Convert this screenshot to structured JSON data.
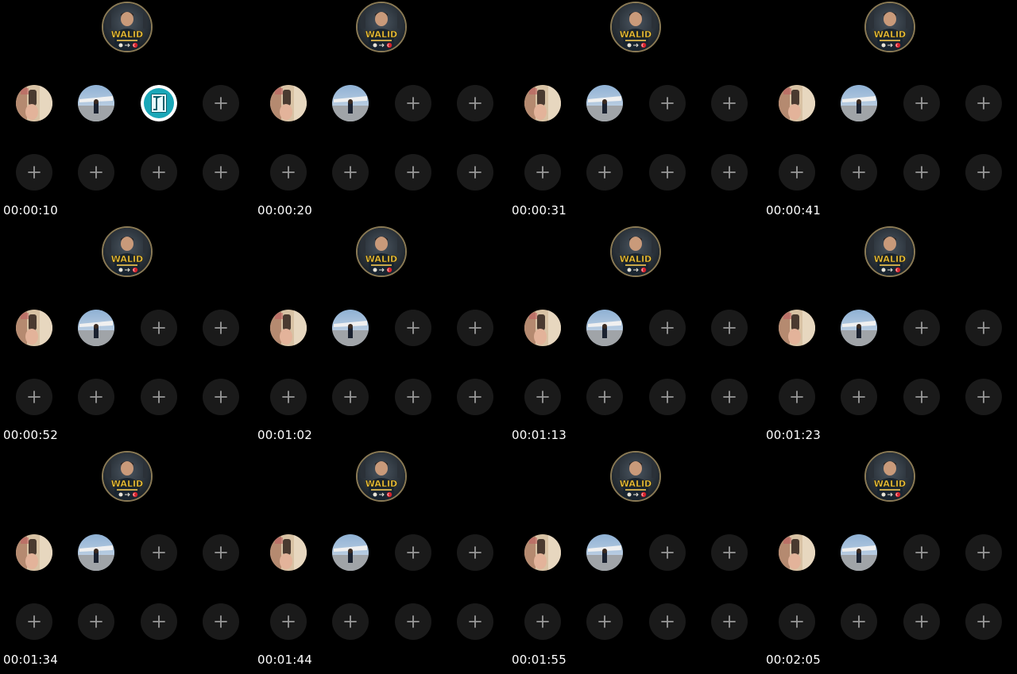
{
  "profile": {
    "name": "WALID",
    "avatar_icon": "profile-avatar-icon"
  },
  "highlight_icons": [
    "story-photo-icon",
    "story-plane-icon",
    "story-door-icon"
  ],
  "add_icon": "plus-icon",
  "frames": [
    {
      "timestamp": "00:00:10",
      "highlights": 3
    },
    {
      "timestamp": "00:00:20",
      "highlights": 2
    },
    {
      "timestamp": "00:00:31",
      "highlights": 2
    },
    {
      "timestamp": "00:00:41",
      "highlights": 2
    },
    {
      "timestamp": "00:00:52",
      "highlights": 2
    },
    {
      "timestamp": "00:01:02",
      "highlights": 2
    },
    {
      "timestamp": "00:01:13",
      "highlights": 2
    },
    {
      "timestamp": "00:01:23",
      "highlights": 2
    },
    {
      "timestamp": "00:01:34",
      "highlights": 2
    },
    {
      "timestamp": "00:01:44",
      "highlights": 2
    },
    {
      "timestamp": "00:01:55",
      "highlights": 2
    },
    {
      "timestamp": "00:02:05",
      "highlights": 2
    }
  ]
}
